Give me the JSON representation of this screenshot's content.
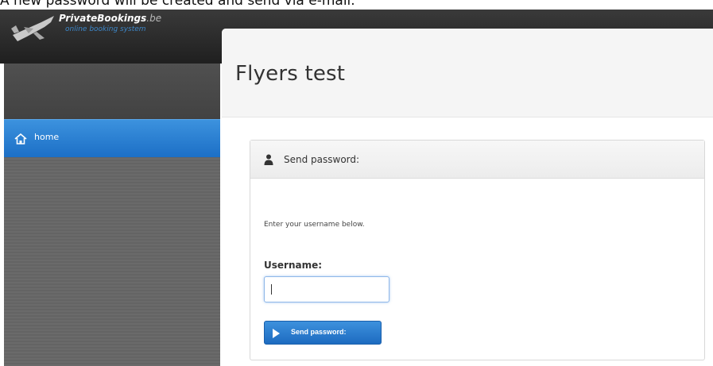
{
  "caption": "A new password will be created and send via e-mail.",
  "logo": {
    "title": "PrivateBookings",
    "tld": ".be",
    "subtitle": "online booking system"
  },
  "sidebar": {
    "items": [
      {
        "label": "home",
        "icon": "home-icon",
        "active": true
      }
    ]
  },
  "page": {
    "title": "Flyers test"
  },
  "card": {
    "icon": "user-icon",
    "title": "Send password:",
    "instructions": "Enter your username below.",
    "username_label": "Username:",
    "username_value": "",
    "submit_label": "Send password:"
  },
  "colors": {
    "accent": "#2a7fd4",
    "sidebar": "#6b6b6b",
    "header": "#2a2a2a"
  }
}
